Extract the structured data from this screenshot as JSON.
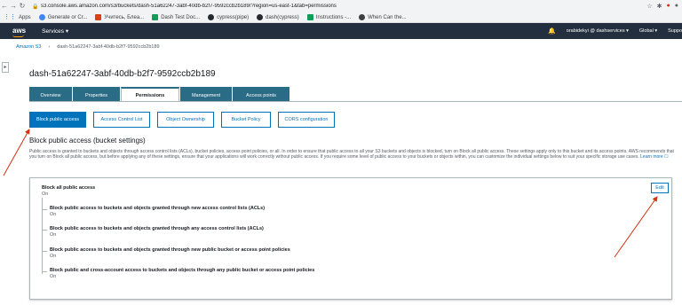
{
  "browser": {
    "url": "s3.console.aws.amazon.com/s3/buckets/dash-51a62247-3abf-40db-b2f7-9592ccb2b189/?region=us-east-1&tab=permissions",
    "bookmarks": [
      {
        "label": "Apps",
        "icon": "apps-icon"
      },
      {
        "label": "Generate or Cr...",
        "icon": "google-icon"
      },
      {
        "label": "Учитесь, Блеа...",
        "icon": "bookmark-icon"
      },
      {
        "label": "Dash Test Doc...",
        "icon": "docs-icon"
      },
      {
        "label": "cypress(pipe)",
        "icon": "github-icon"
      },
      {
        "label": "dash(cypress)",
        "icon": "github-icon"
      },
      {
        "label": "Instructions -...",
        "icon": "sheets-icon"
      },
      {
        "label": "When Can the...",
        "icon": "bookmark-icon"
      }
    ]
  },
  "aws": {
    "logo": "aws",
    "services": "Services ▾",
    "user": "orabidekyi @ dashservices ▾",
    "region": "Global ▾",
    "support": "Suppo"
  },
  "breadcrumb": {
    "root": "Amazon S3",
    "sep": "›",
    "current": "dash-51a62247-3abf-40db-b2f7-9592ccb2b189"
  },
  "bucket_title": "dash-51a62247-3abf-40db-b2f7-9592ccb2b189",
  "tabs": [
    "Overview",
    "Properties",
    "Permissions",
    "Management",
    "Access points"
  ],
  "sub_buttons": [
    "Block public access",
    "Access Control List",
    "Object Ownership",
    "Bucket Policy",
    "CORS configuration"
  ],
  "section": {
    "title": "Block public access (bucket settings)",
    "description": "Public access is granted to buckets and objects through access control lists (ACLs), bucket policies, access point policies, or all. In order to ensure that public access to all your S3 buckets and objects is blocked, turn on Block all public access. These settings apply only to this bucket and its access points. AWS recommends that you turn on Block all public access, but before applying any of these settings, ensure that your applications will work correctly without public access. If you require some level of public access to your buckets or objects within, you can customize the individual settings below to suit your specific storage use cases.",
    "learn_more": "Learn more ☐"
  },
  "box": {
    "edit": "Edit",
    "main_title": "Block all public access",
    "main_value": "On",
    "rows": [
      {
        "title": "Block public access to buckets and objects granted through new access control lists (ACLs)",
        "value": "On"
      },
      {
        "title": "Block public access to buckets and objects granted through any access control lists (ACLs)",
        "value": "On"
      },
      {
        "title": "Block public access to buckets and objects granted through new public bucket or access point policies",
        "value": "On"
      },
      {
        "title": "Block public and cross-account access to buckets and objects through any public bucket or access point policies",
        "value": "On"
      }
    ]
  },
  "colors": {
    "aws_nav": "#232f3e",
    "link": "#0073bb",
    "tab": "#2a6b85",
    "annotation": "#d13212"
  }
}
